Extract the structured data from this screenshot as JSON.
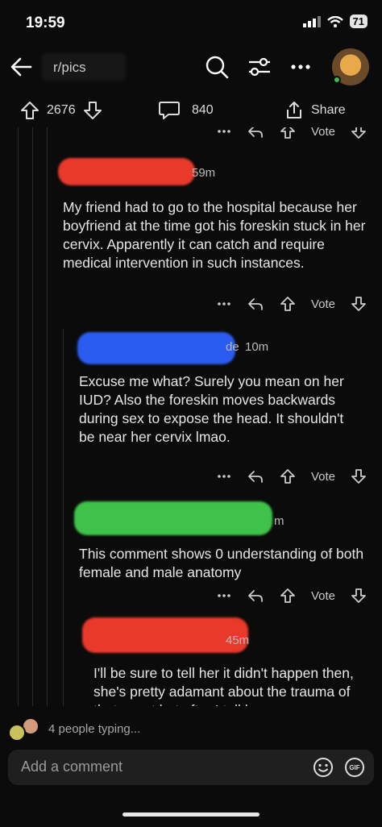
{
  "status": {
    "time": "19:59",
    "battery": "71"
  },
  "header": {
    "subreddit": "r/pics"
  },
  "post_actions": {
    "upvotes": "2676",
    "comments": "840",
    "share_label": "Share"
  },
  "comments": [
    {
      "time": "59m",
      "text": "My friend had to go to the hospital because her boyfriend at the time got his foreskin stuck in her cervix. Apparently it can catch and require medical intervention in such instances.",
      "vote_label": "Vote",
      "redact_color": "#e8392b"
    },
    {
      "time": "10m",
      "author_tail": "de",
      "text": "Excuse me what? Surely you mean on her IUD? Also the foreskin moves backwards during sex to expose the head. It shouldn't be near her cervix lmao.",
      "vote_label": "Vote",
      "redact_color": "#2a5cf0"
    },
    {
      "time": "m",
      "text": "This comment shows 0 understanding of both female and male anatomy",
      "vote_label": "Vote",
      "redact_color": "#3fc24a"
    },
    {
      "time": "45m",
      "text": "I'll be sure to tell her it didn't happen then, she's pretty adamant about the trauma of that event but after I tell her",
      "redact_color": "#e8392b"
    }
  ],
  "top_partial_vote": "Vote",
  "typing": {
    "text": "4 people typing..."
  },
  "composer": {
    "placeholder": "Add a comment",
    "gif_label": "GIF"
  }
}
